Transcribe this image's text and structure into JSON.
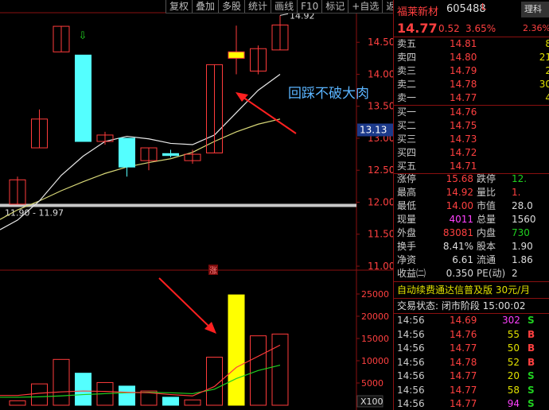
{
  "toolbar": {
    "buttons": [
      "复权",
      "叠加",
      "多股",
      "统计",
      "画线",
      "F10",
      "标记",
      "+自选",
      "返回"
    ]
  },
  "stock": {
    "name": "福莱新材",
    "code": "605488",
    "mark": "L",
    "badge": "理科",
    "price": "14.77",
    "change": "0.52",
    "change_pct": "3.65%",
    "right_pct": "2.36%"
  },
  "order_book": {
    "sell": [
      {
        "label": "卖五",
        "price": "14.81",
        "vol": "8"
      },
      {
        "label": "卖四",
        "price": "14.80",
        "vol": "21"
      },
      {
        "label": "卖三",
        "price": "14.79",
        "vol": "2"
      },
      {
        "label": "卖二",
        "price": "14.78",
        "vol": "30"
      },
      {
        "label": "卖一",
        "price": "14.77",
        "vol": "4"
      }
    ],
    "buy": [
      {
        "label": "买一",
        "price": "14.76",
        "vol": ""
      },
      {
        "label": "买二",
        "price": "14.75",
        "vol": ""
      },
      {
        "label": "买三",
        "price": "14.73",
        "vol": ""
      },
      {
        "label": "买四",
        "price": "14.72",
        "vol": ""
      },
      {
        "label": "买五",
        "price": "14.71",
        "vol": ""
      }
    ]
  },
  "stats": [
    {
      "l1": "涨停",
      "v1": "15.68",
      "c1": "red",
      "l2": "跌停",
      "v2": "12.",
      "c2": "green"
    },
    {
      "l1": "最高",
      "v1": "14.92",
      "c1": "red",
      "l2": "量比",
      "v2": "1.",
      "c2": "red"
    },
    {
      "l1": "最低",
      "v1": "14.00",
      "c1": "red",
      "l2": "市值",
      "v2": "28.0",
      "c2": "white"
    },
    {
      "l1": "现量",
      "v1": "4011",
      "c1": "mag",
      "l2": "总量",
      "v2": "1560",
      "c2": "white"
    },
    {
      "l1": "外盘",
      "v1": "83081",
      "c1": "red",
      "l2": "内盘",
      "v2": "730",
      "c2": "green"
    },
    {
      "l1": "换手",
      "v1": "8.41%",
      "c1": "white",
      "l2": "股本",
      "v2": "1.90",
      "c2": "white"
    },
    {
      "l1": "净资",
      "v1": "6.61",
      "c1": "white",
      "l2": "流通",
      "v2": "1.86",
      "c2": "white"
    },
    {
      "l1": "收益㈡",
      "v1": "0.350",
      "c1": "white",
      "l2": "PE(动)",
      "v2": "2",
      "c2": "white"
    }
  ],
  "banner1": "自动续费通达信普及版 30元/月",
  "banner2": "交易状态: 闭市阶段 15:00:02",
  "trades": [
    {
      "t": "14:56",
      "p": "14.69",
      "v": "302",
      "s": "S",
      "vc": "mag",
      "sc": "green"
    },
    {
      "t": "14:56",
      "p": "14.76",
      "v": "55",
      "s": "B",
      "vc": "yellow",
      "sc": "red"
    },
    {
      "t": "14:56",
      "p": "14.77",
      "v": "50",
      "s": "B",
      "vc": "yellow",
      "sc": "red"
    },
    {
      "t": "14:56",
      "p": "14.78",
      "v": "52",
      "s": "B",
      "vc": "yellow",
      "sc": "red"
    },
    {
      "t": "14:56",
      "p": "14.77",
      "v": "20",
      "s": "S",
      "vc": "yellow",
      "sc": "green"
    },
    {
      "t": "14:56",
      "p": "14.77",
      "v": "58",
      "s": "S",
      "vc": "yellow",
      "sc": "green"
    },
    {
      "t": "14:56",
      "p": "14.77",
      "v": "94",
      "s": "S",
      "vc": "mag",
      "sc": "green"
    },
    {
      "t": "14:56",
      "p": "14.77",
      "v": "",
      "s": "S",
      "vc": "yellow",
      "sc": "green"
    }
  ],
  "chart_data": {
    "type": "candlestick",
    "price_axis": {
      "ticks": [
        "14.50",
        "14.00",
        "13.50",
        "13.00",
        "12.50",
        "12.00",
        "11.50",
        "11.00"
      ],
      "current_label": "13.13",
      "range": [
        11.0,
        14.9
      ]
    },
    "candles": [
      {
        "o": 11.97,
        "h": 12.4,
        "l": 11.97,
        "c": 12.35
      },
      {
        "o": 12.85,
        "h": 13.45,
        "l": 12.85,
        "c": 13.3
      },
      {
        "o": 14.35,
        "h": 14.75,
        "l": 14.35,
        "c": 14.75
      },
      {
        "o": 14.3,
        "h": 14.3,
        "l": 12.95,
        "c": 12.95
      },
      {
        "o": 12.95,
        "h": 13.1,
        "l": 12.9,
        "c": 13.05
      },
      {
        "o": 13.0,
        "h": 13.0,
        "l": 12.4,
        "c": 12.55
      },
      {
        "o": 12.65,
        "h": 12.85,
        "l": 12.5,
        "c": 12.85
      },
      {
        "o": 12.76,
        "h": 12.82,
        "l": 12.7,
        "c": 12.73
      },
      {
        "o": 12.65,
        "h": 12.82,
        "l": 12.6,
        "c": 12.75
      },
      {
        "o": 12.77,
        "h": 14.15,
        "l": 12.77,
        "c": 14.15
      },
      {
        "o": 14.25,
        "h": 14.76,
        "l": 14.0,
        "c": 14.35
      },
      {
        "o": 14.05,
        "h": 14.45,
        "l": 14.0,
        "c": 14.4
      },
      {
        "o": 14.38,
        "h": 14.92,
        "l": 14.38,
        "c": 14.77
      }
    ],
    "ma_white": [
      11.72,
      12.02,
      12.42,
      12.72,
      12.95,
      13.03,
      12.99,
      12.92,
      12.9,
      13.05,
      13.4,
      13.75,
      14.0
    ],
    "ma_yellow": [
      11.88,
      12.02,
      12.18,
      12.32,
      12.45,
      12.55,
      12.62,
      12.68,
      12.78,
      12.95,
      13.1,
      13.22,
      13.3
    ],
    "support_label": "11.90 - 11.97",
    "support_price": 11.95,
    "high_label": "14.92",
    "annotation": "回踩不破大肉",
    "volume_axis": {
      "ticks": [
        "25000",
        "20000",
        "15000",
        "10000",
        "5000"
      ],
      "unit": "X100",
      "max": 25000
    },
    "volumes": [
      1000,
      4800,
      10300,
      7200,
      5100,
      4300,
      3200,
      1800,
      1200,
      10800,
      24800,
      15600,
      16000
    ],
    "vol_ma_red": [
      2200,
      2700,
      3000,
      3200,
      3100,
      2900,
      2800,
      2400,
      2100,
      4200,
      8500,
      11000,
      13500
    ],
    "vol_ma_green": [
      1800,
      1900,
      2100,
      2400,
      2600,
      2800,
      2900,
      2800,
      2600,
      3600,
      6000,
      7800,
      9000
    ]
  }
}
